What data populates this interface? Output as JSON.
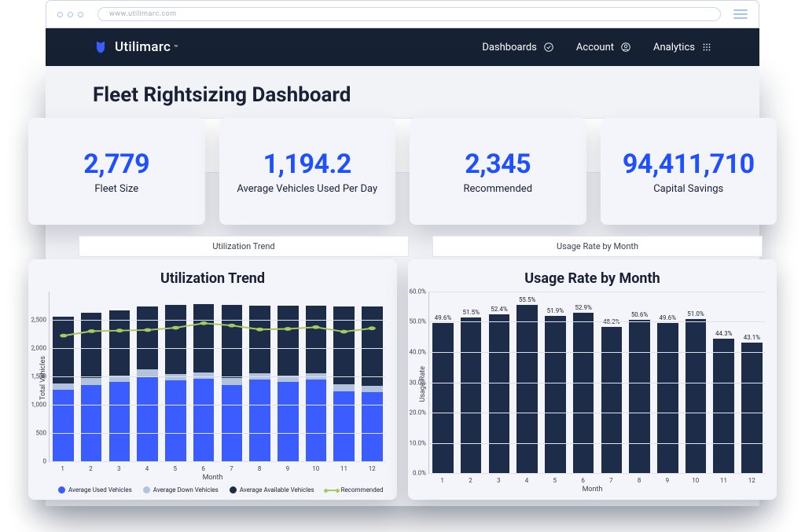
{
  "browser": {
    "url": "www.utilimarc.com"
  },
  "brand": {
    "name": "Utilimarc"
  },
  "nav": {
    "dashboards": "Dashboards",
    "account": "Account",
    "analytics": "Analytics"
  },
  "page": {
    "title": "Fleet Rightsizing Dashboard"
  },
  "metrics": [
    {
      "value": "2,779",
      "label": "Fleet Size"
    },
    {
      "value": "1,194.2",
      "label": "Average Vehicles Used Per Day"
    },
    {
      "value": "2,345",
      "label": "Recommended"
    },
    {
      "value": "94,411,710",
      "label": "Capital Savings"
    }
  ],
  "strip_titles": {
    "left": "Utilization Trend",
    "right": "Usage Rate by Month"
  },
  "chart_data": [
    {
      "type": "bar",
      "title": "Utilization Trend",
      "xlabel": "Month",
      "ylabel": "Total Vehicles",
      "ylim": [
        0,
        3000
      ],
      "yticks": [
        0,
        500,
        1000,
        1500,
        2000,
        2500
      ],
      "categories": [
        "1",
        "2",
        "3",
        "4",
        "5",
        "6",
        "7",
        "8",
        "9",
        "10",
        "11",
        "12"
      ],
      "series": [
        {
          "name": "Average Used Vehicles",
          "values": [
            1260,
            1350,
            1400,
            1500,
            1430,
            1460,
            1350,
            1440,
            1400,
            1440,
            1240,
            1220
          ]
        },
        {
          "name": "Average Down Vehicles",
          "values": [
            120,
            120,
            120,
            120,
            110,
            110,
            120,
            110,
            110,
            110,
            120,
            120
          ]
        },
        {
          "name": "Average Available Vehicles",
          "values": [
            1180,
            1150,
            1150,
            1120,
            1230,
            1210,
            1300,
            1200,
            1240,
            1200,
            1380,
            1400
          ]
        },
        {
          "name": "Recommended",
          "type": "line",
          "values": [
            2220,
            2300,
            2310,
            2320,
            2360,
            2440,
            2400,
            2330,
            2340,
            2370,
            2290,
            2350
          ]
        }
      ]
    },
    {
      "type": "bar",
      "title": "Usage Rate by Month",
      "xlabel": "Month",
      "ylabel": "Usage Rate",
      "ylim": [
        0,
        60
      ],
      "yticks": [
        0,
        10,
        20,
        30,
        40,
        50,
        60
      ],
      "categories": [
        "1",
        "2",
        "3",
        "4",
        "5",
        "6",
        "7",
        "8",
        "9",
        "10",
        "11",
        "12"
      ],
      "series": [
        {
          "name": "Usage Rate",
          "values": [
            49.6,
            51.5,
            52.4,
            55.5,
            51.9,
            52.9,
            48.2,
            50.6,
            49.6,
            51.0,
            44.3,
            43.1
          ]
        }
      ],
      "label_format": "percent1"
    }
  ],
  "legend": {
    "used": "Average Used Vehicles",
    "down": "Average Down Vehicles",
    "avail": "Average Available Vehicles",
    "rec": "Recommended"
  }
}
